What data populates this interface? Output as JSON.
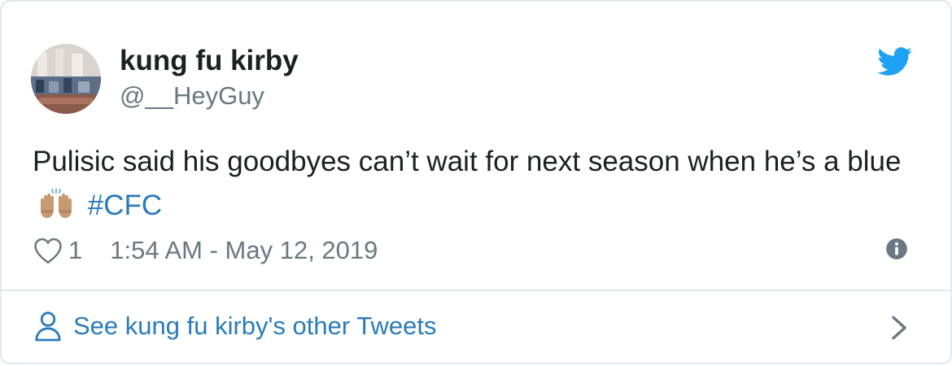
{
  "author": {
    "name": "kung fu kirby",
    "handle": "@__HeyGuy"
  },
  "tweet": {
    "text_before": "Pulisic said his goodbyes can’t wait for next season when he’s a blue",
    "emoji": "raising-hands-emoji",
    "hashtag": "#CFC"
  },
  "meta": {
    "like_count": "1",
    "timestamp": "1:54 AM - May 12, 2019"
  },
  "footer": {
    "link_label": "See kung fu kirby's other Tweets"
  },
  "icons": {
    "brand": "twitter-bird-icon",
    "like": "heart-icon",
    "info": "info-icon",
    "profile": "person-icon",
    "next": "chevron-right-icon"
  },
  "colors": {
    "brand": "#1da1f2",
    "link": "#2b7bb9",
    "secondary_text": "#697882",
    "border": "#e1e8ed"
  }
}
